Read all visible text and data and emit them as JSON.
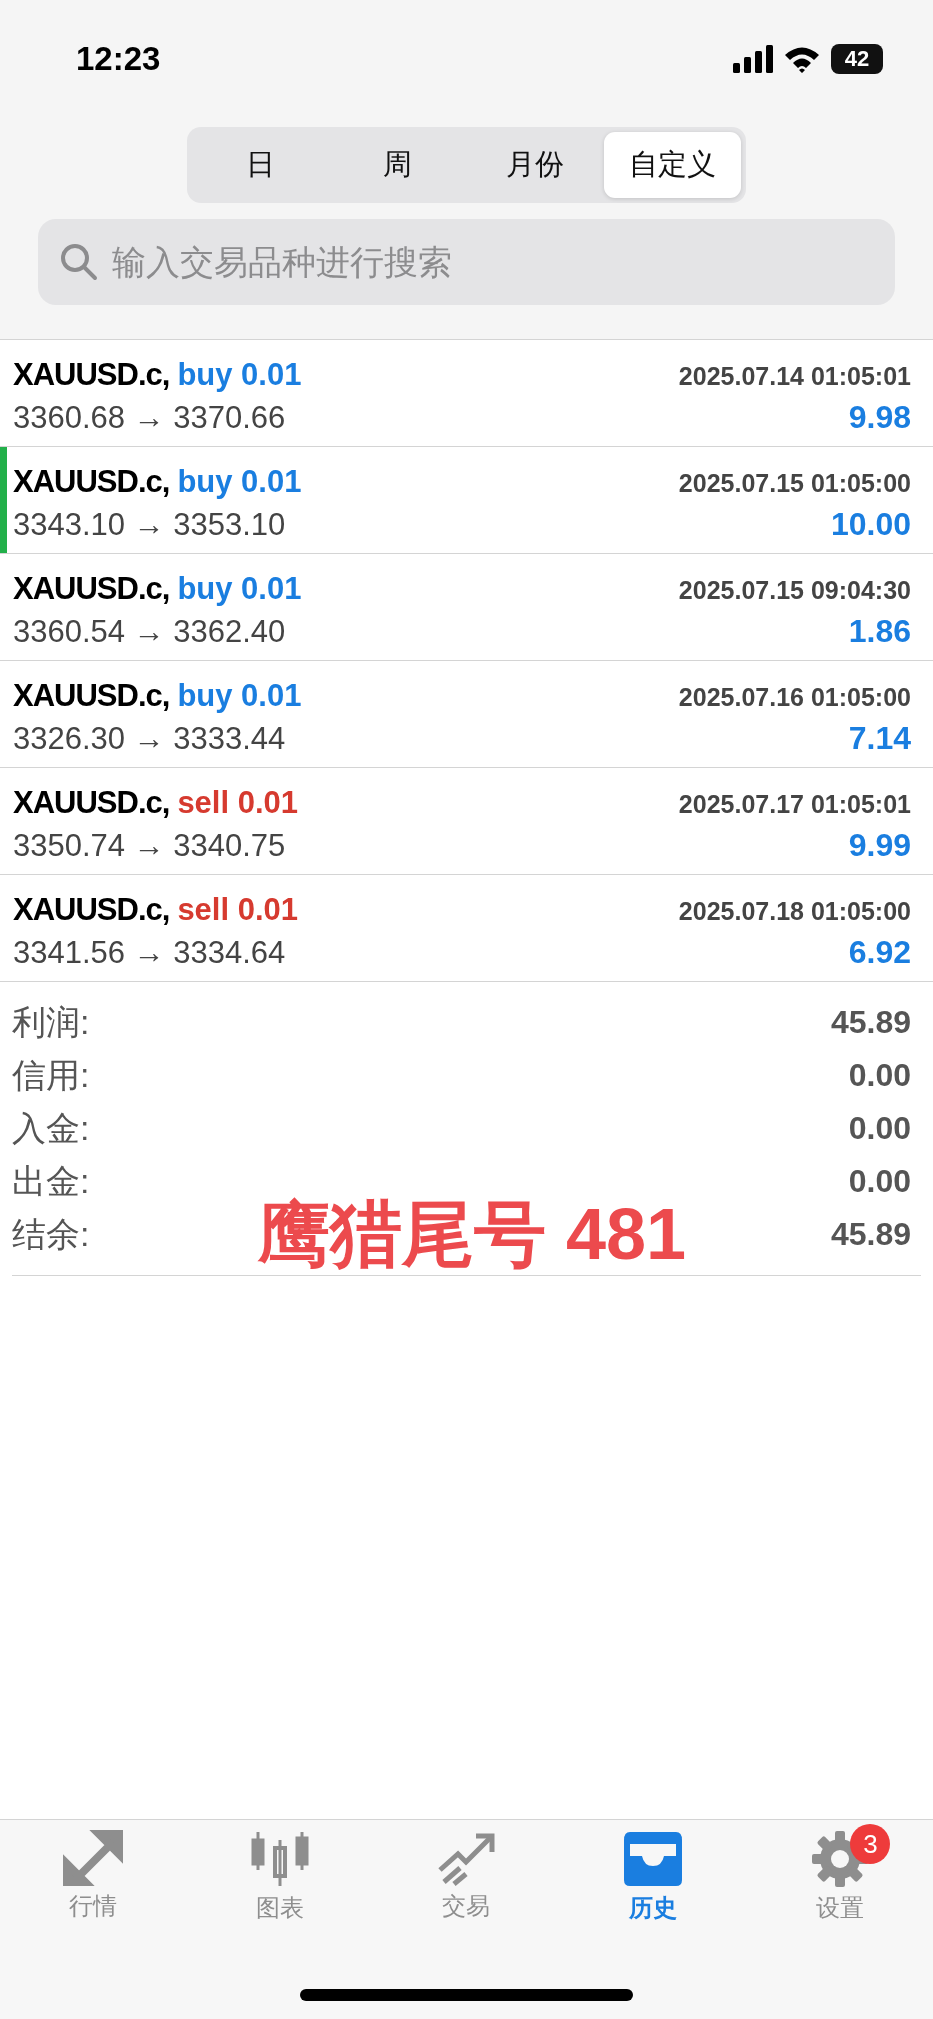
{
  "status_bar": {
    "time": "12:23",
    "battery": "42"
  },
  "period_tabs": [
    {
      "label": "日",
      "selected": false
    },
    {
      "label": "周",
      "selected": false
    },
    {
      "label": "月份",
      "selected": false
    },
    {
      "label": "自定义",
      "selected": true
    }
  ],
  "search": {
    "placeholder": "输入交易品种进行搜索"
  },
  "deals": [
    {
      "symbol": "XAUUSD.c,",
      "kind": "buy",
      "order": "buy 0.01",
      "time": "2025.07.14 01:05:01",
      "prices": "3360.68 → 3370.66",
      "profit": "9.98",
      "selected": false
    },
    {
      "symbol": "XAUUSD.c,",
      "kind": "buy",
      "order": "buy 0.01",
      "time": "2025.07.15 01:05:00",
      "prices": "3343.10 → 3353.10",
      "profit": "10.00",
      "selected": true
    },
    {
      "symbol": "XAUUSD.c,",
      "kind": "buy",
      "order": "buy 0.01",
      "time": "2025.07.15 09:04:30",
      "prices": "3360.54 → 3362.40",
      "profit": "1.86",
      "selected": false
    },
    {
      "symbol": "XAUUSD.c,",
      "kind": "buy",
      "order": "buy 0.01",
      "time": "2025.07.16 01:05:00",
      "prices": "3326.30 → 3333.44",
      "profit": "7.14",
      "selected": false
    },
    {
      "symbol": "XAUUSD.c,",
      "kind": "sell",
      "order": "sell 0.01",
      "time": "2025.07.17 01:05:01",
      "prices": "3350.74 → 3340.75",
      "profit": "9.99",
      "selected": false
    },
    {
      "symbol": "XAUUSD.c,",
      "kind": "sell",
      "order": "sell 0.01",
      "time": "2025.07.18 01:05:00",
      "prices": "3341.56 → 3334.64",
      "profit": "6.92",
      "selected": false
    }
  ],
  "summary": [
    {
      "label": "利润:",
      "value": "45.89"
    },
    {
      "label": "信用:",
      "value": "0.00"
    },
    {
      "label": "入金:",
      "value": "0.00"
    },
    {
      "label": "出金:",
      "value": "0.00"
    },
    {
      "label": "结余:",
      "value": "45.89"
    }
  ],
  "overlay_label": "鹰猎尾号 481",
  "tab_bar": [
    {
      "kind": "quotes",
      "label": "行情",
      "selected": false
    },
    {
      "kind": "chart",
      "label": "图表",
      "selected": false
    },
    {
      "kind": "trade",
      "label": "交易",
      "selected": false
    },
    {
      "kind": "history",
      "label": "历史",
      "selected": true
    },
    {
      "kind": "settings",
      "label": "设置",
      "selected": false,
      "badge": "3"
    }
  ]
}
